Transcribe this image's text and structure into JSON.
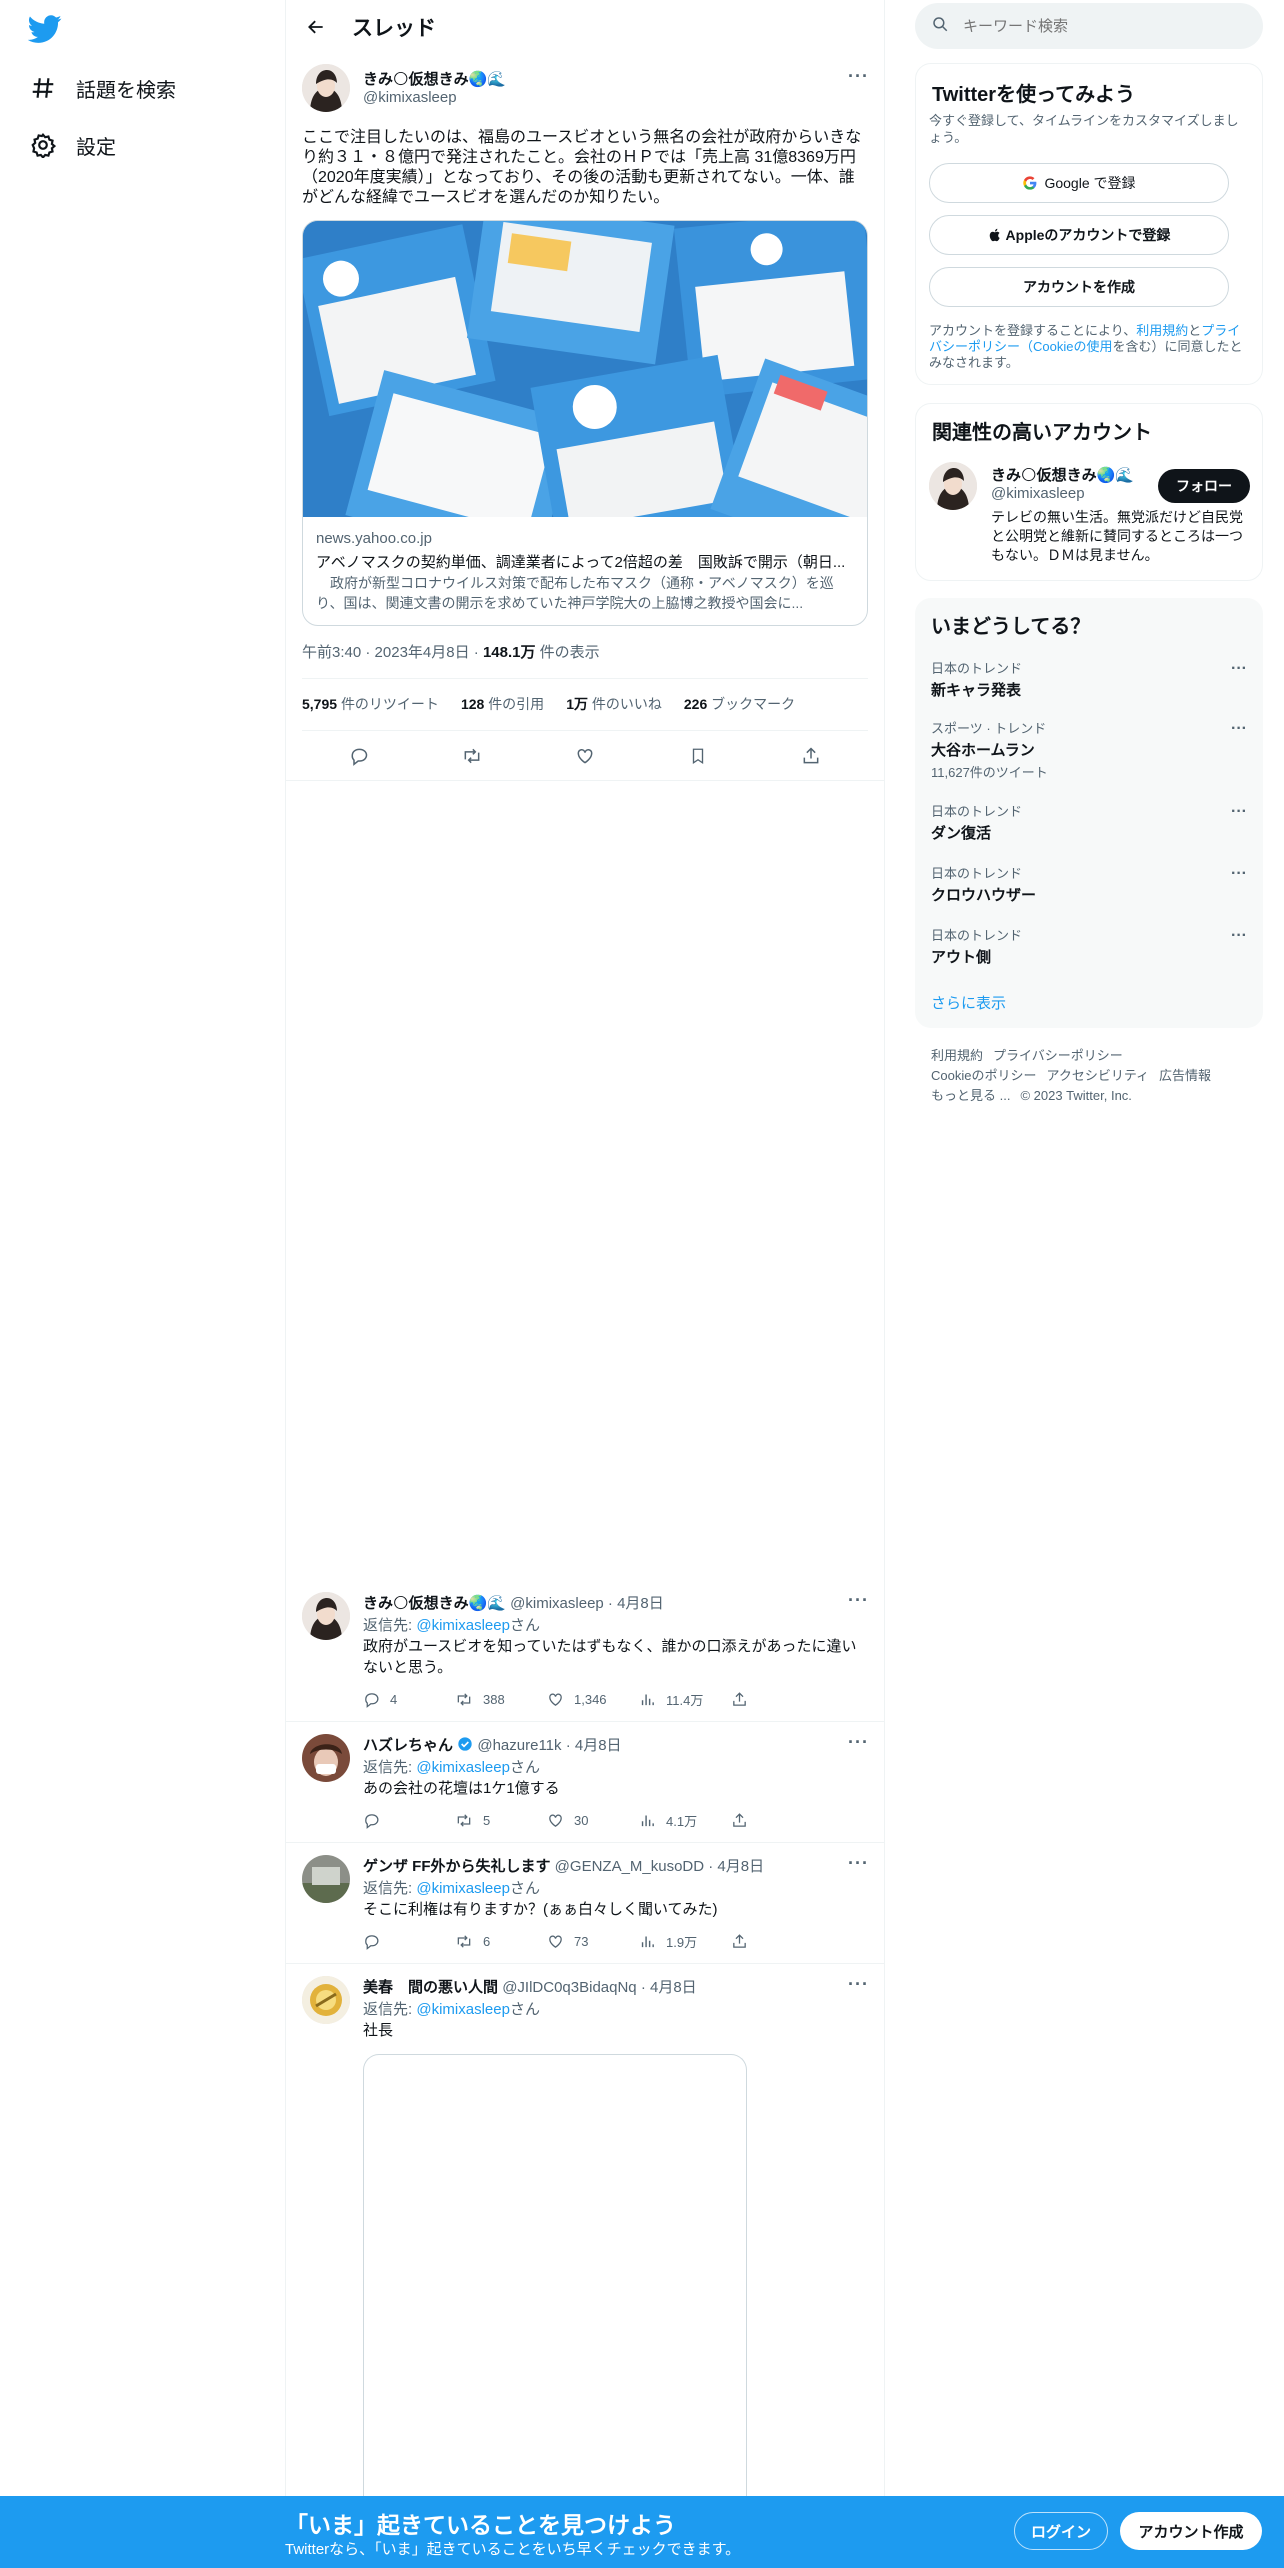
{
  "nav": {
    "explore_label": "話題を検索",
    "settings_label": "設定"
  },
  "thread": {
    "title": "スレッド"
  },
  "main_tweet": {
    "name": "きみ🌕仮想きみ🌏🌊",
    "handle": "@kimixasleep",
    "text": "ここで注目したいのは、福島のユースビオという無名の会社が政府からいきなり約３１・８億円で発注されたこと。会社のＨＰでは「売上高 31億8369万円（2020年度実績）」となっており、その後の活動も更新されてない。一体、誰がどんな経緯でユースビオを選んだのか知りたい。",
    "card": {
      "domain": "news.yahoo.co.jp",
      "title": "アベノマスクの契約単価、調達業者によって2倍超の差　国敗訴で開示（朝日...",
      "description": "　政府が新型コロナウイルス対策で配布した布マスク（通称・アベノマスク）を巡り、国は、関連文書の開示を求めていた神戸学院大の上脇博之教授や国会に..."
    },
    "time": "午前3:40",
    "date": "2023年4月8日",
    "views_value": "148.1万",
    "views_label": "件の表示",
    "stats": {
      "retweets_value": "5,795",
      "retweets_label": "件のリツイート",
      "quotes_value": "128",
      "quotes_label": "件の引用",
      "likes_value": "1万",
      "likes_label": "件のいいね",
      "bookmarks_value": "226",
      "bookmarks_label": "ブックマーク"
    }
  },
  "replies": [
    {
      "name": "きみ🌕仮想きみ🌏🌊",
      "handle_date": "@kimixasleep · 4月8日",
      "reply_to_prefix": "返信先: ",
      "reply_to_handle": "@kimixasleep",
      "reply_to_suffix": "さん",
      "text": "政府がユースビオを知っていたはずもなく、誰かの口添えがあったに違いないと思う。",
      "replies": "4",
      "retweets": "388",
      "likes": "1,346",
      "views": "11.4万"
    },
    {
      "name": "ハズレちゃん",
      "handle_date": "@hazure11k · 4月8日",
      "reply_to_prefix": "返信先: ",
      "reply_to_handle": "@kimixasleep",
      "reply_to_suffix": "さん",
      "text": "あの会社の花壇は1ケ1億する",
      "replies": "",
      "retweets": "5",
      "likes": "30",
      "views": "4.1万"
    },
    {
      "name": "ゲンザ FF外から失礼します",
      "handle_date": "@GENZA_M_kusoDD · 4月8日",
      "reply_to_prefix": "返信先: ",
      "reply_to_handle": "@kimixasleep",
      "reply_to_suffix": "さん",
      "text": "そこに利権は有りますか？(ぁぁ白々しく聞いてみた)",
      "replies": "",
      "retweets": "6",
      "likes": "73",
      "views": "1.9万"
    },
    {
      "name": "美春　間の悪い人間",
      "handle_date": "@JIlDC0q3BidaqNq · 4月8日",
      "reply_to_prefix": "返信先: ",
      "reply_to_handle": "@kimixasleep",
      "reply_to_suffix": "さん",
      "text": "社長"
    }
  ],
  "sidebar": {
    "search_placeholder": "キーワード検索",
    "signup_panel": {
      "title": "Twitterを使ってみよう",
      "subtitle": "今すぐ登録して、タイムラインをカスタマイズしましょう。",
      "google_label": "Google で登録",
      "apple_label": "Appleのアカウントで登録",
      "create_label": "アカウントを作成",
      "terms_prefix": "アカウントを登録することにより、",
      "terms_link": "利用規約",
      "terms_and": "と",
      "privacy_link": "プライバシーポリシー（Cookieの使用",
      "terms_suffix": "を含む）に同意したとみなされます。"
    },
    "related_panel": {
      "title": "関連性の高いアカウント",
      "name": "きみ🌕仮想きみ🌏🌊",
      "handle": "@kimixasleep",
      "follow_label": "フォロー",
      "bio": "テレビの無い生活。無党派だけど自民党と公明党と維新に賛同するところは一つもない。ＤＭは見ません。"
    },
    "trends_panel": {
      "title": "いまどうしてる？",
      "items": [
        {
          "category": "日本のトレンド",
          "name": "新キャラ発表",
          "count": ""
        },
        {
          "category": "スポーツ · トレンド",
          "name": "大谷ホームラン",
          "count": "11,627件のツイート"
        },
        {
          "category": "日本のトレンド",
          "name": "ダン復活",
          "count": ""
        },
        {
          "category": "日本のトレンド",
          "name": "クロウハウザー",
          "count": ""
        },
        {
          "category": "日本のトレンド",
          "name": "アウト側",
          "count": ""
        }
      ],
      "show_more": "さらに表示"
    },
    "footer": {
      "terms": "利用規約",
      "privacy": "プライバシーポリシー",
      "cookie": "Cookieのポリシー",
      "accessibility": "アクセシビリティ",
      "ads": "広告情報",
      "more": "もっと見る ...",
      "copyright": "© 2023 Twitter, Inc."
    }
  },
  "bottom_bar": {
    "title": "「いま」起きていることを見つけよう",
    "subtitle": "Twitterなら、「いま」起きていることをいち早くチェックできます。",
    "login_label": "ログイン",
    "signup_label": "アカウント作成"
  },
  "colors": {
    "accent": "#1d9bf0",
    "text": "#0f1419",
    "muted": "#536471",
    "border": "#eff3f4"
  }
}
